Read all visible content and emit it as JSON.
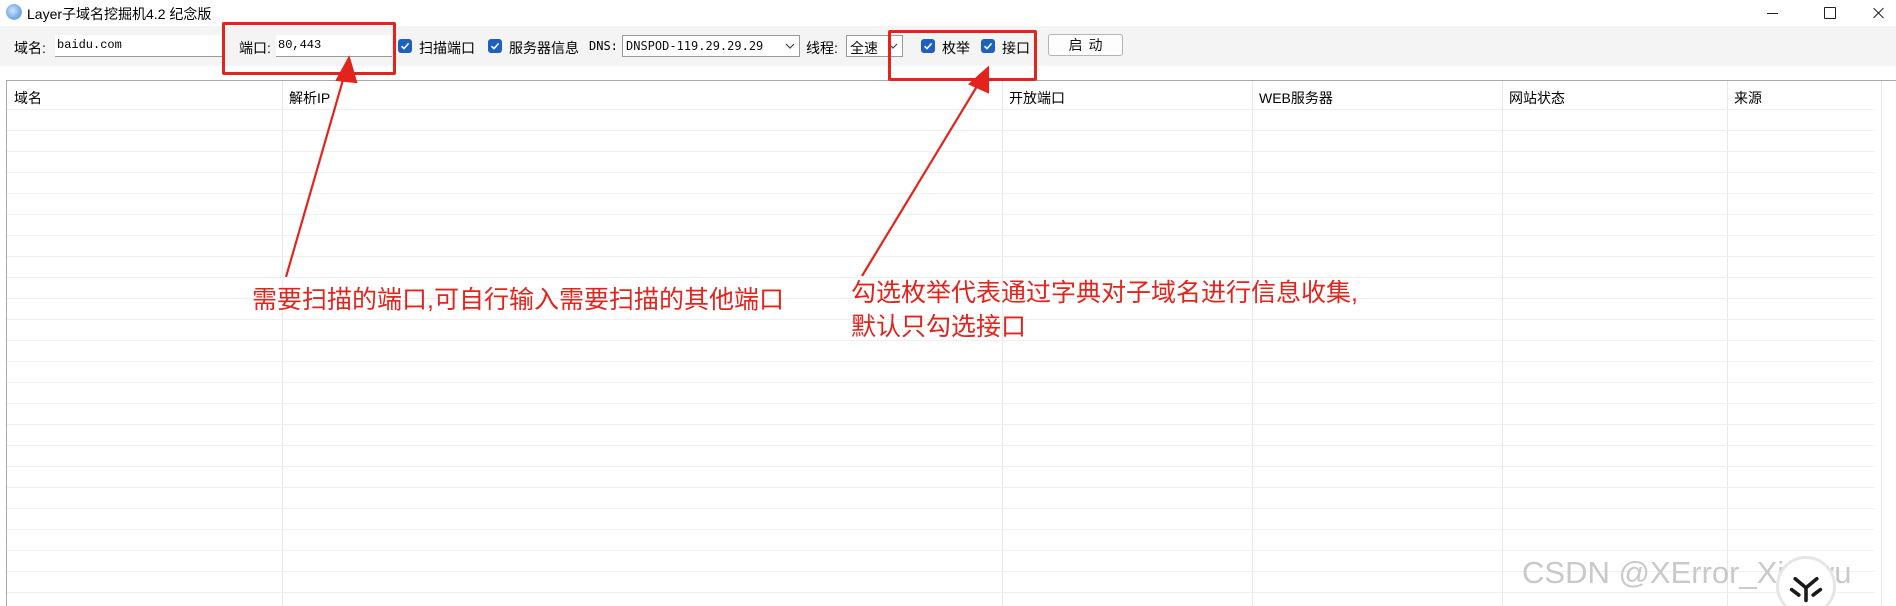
{
  "window": {
    "title": "Layer子域名挖掘机4.2 纪念版",
    "icon": "app-logo-icon"
  },
  "toolbar": {
    "domain_label": "域名:",
    "domain_value": "baidu.com",
    "port_label": "端口:",
    "port_value": "80,443",
    "scan_ports_label": "扫描端口",
    "scan_ports_checked": true,
    "server_info_label": "服务器信息",
    "server_info_checked": true,
    "dns_label": "DNS:",
    "dns_value": "DNSPOD-119.29.29.29",
    "threads_label": "线程:",
    "threads_value": "全速",
    "enumerate_label": "枚举",
    "enumerate_checked": true,
    "interface_label": "接口",
    "interface_checked": true,
    "start_label": "启动"
  },
  "table": {
    "columns": [
      "域名",
      "解析IP",
      "开放端口",
      "WEB服务器",
      "网站状态",
      "来源"
    ],
    "rows": []
  },
  "annotations": {
    "port_note": "需要扫描的端口,可自行输入需要扫描的其他端口",
    "enum_note_line1": "勾选枚举代表通过字典对子域名进行信息收集,",
    "enum_note_line2": "默认只勾选接口",
    "color": "#e3241d"
  },
  "watermark": {
    "text": "CSDN @XError_Xiaoyu"
  },
  "colors": {
    "checkbox": "#1f5fbf",
    "annotation_red": "#e3241d"
  }
}
